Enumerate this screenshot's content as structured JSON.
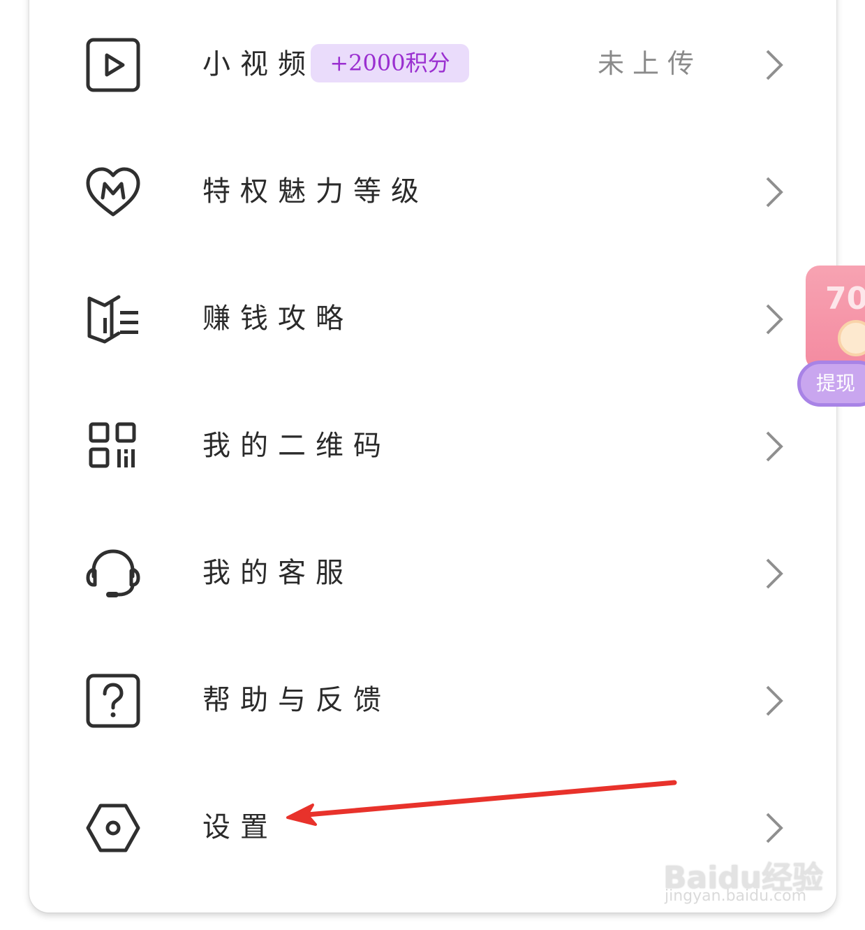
{
  "menu": {
    "items": [
      {
        "label": "小视频",
        "badge": "+2000积分",
        "status": "未上传",
        "icon": "play-video-icon"
      },
      {
        "label": "特权魅力等级",
        "icon": "heart-m-icon"
      },
      {
        "label": "赚钱攻略",
        "icon": "guide-book-icon"
      },
      {
        "label": "我的二维码",
        "icon": "qr-code-icon"
      },
      {
        "label": "我的客服",
        "icon": "headset-icon"
      },
      {
        "label": "帮助与反馈",
        "icon": "help-question-icon"
      },
      {
        "label": "设置",
        "icon": "settings-hexagon-icon"
      }
    ],
    "chevron_icon": "chevron-right-icon"
  },
  "floating_widget": {
    "amount": "70",
    "button_label": "提现"
  },
  "watermark": {
    "brand": "Baidu经验",
    "url": "jingyan.baidu.com"
  },
  "annotation": {
    "color": "#e8322b",
    "points_to": "设置"
  },
  "colors": {
    "badge_bg": "#eadcfb",
    "badge_text": "#9a2fd0",
    "icon_stroke": "#2f2f2f",
    "chevron": "#8f8f8f"
  }
}
